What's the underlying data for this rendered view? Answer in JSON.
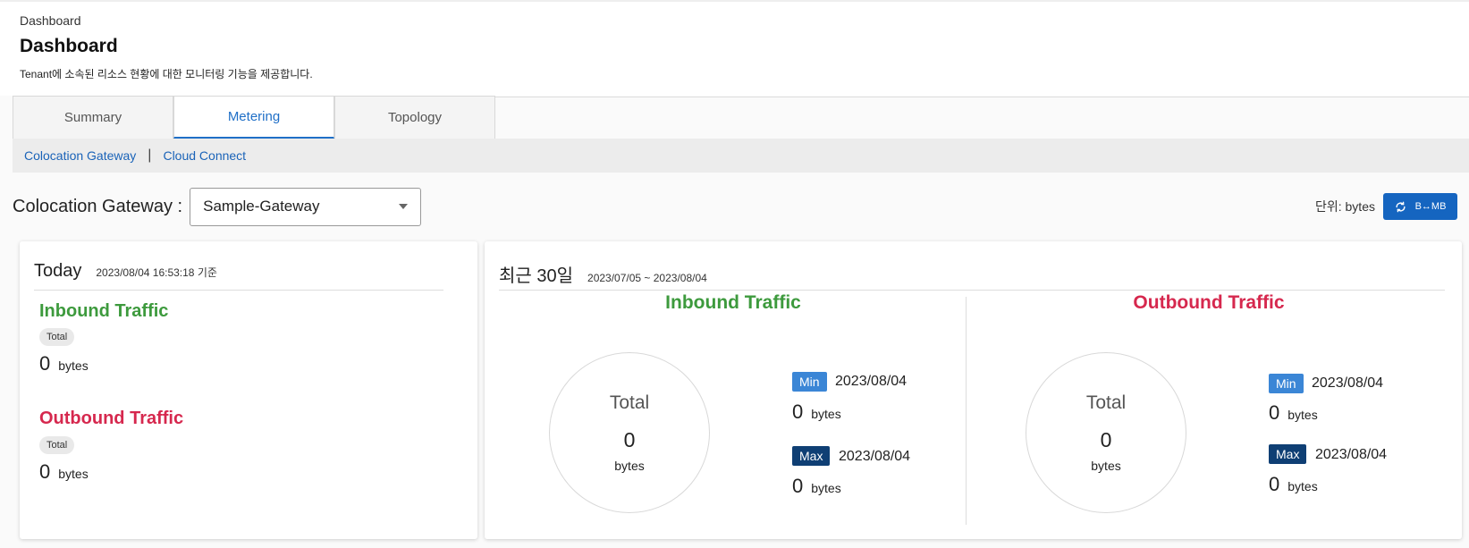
{
  "header": {
    "breadcrumb": "Dashboard",
    "title": "Dashboard",
    "description": "Tenant에 소속된 리소스 현황에 대한 모니터링 기능을 제공합니다."
  },
  "tabs": [
    {
      "label": "Summary",
      "active": false
    },
    {
      "label": "Metering",
      "active": true
    },
    {
      "label": "Topology",
      "active": false
    }
  ],
  "subnav": {
    "items": [
      "Colocation Gateway",
      "Cloud Connect"
    ],
    "separator": "|"
  },
  "selector": {
    "label": "Colocation Gateway :",
    "value": "Sample-Gateway"
  },
  "unit": {
    "text": "단위: bytes",
    "button_label": "B↔MB"
  },
  "today": {
    "title": "Today",
    "timestamp": "2023/08/04 16:53:18 기준",
    "inbound": {
      "title": "Inbound Traffic",
      "pill": "Total",
      "value": "0",
      "unit": "bytes"
    },
    "outbound": {
      "title": "Outbound Traffic",
      "pill": "Total",
      "value": "0",
      "unit": "bytes"
    }
  },
  "recent": {
    "title": "최근 30일",
    "range": "2023/07/05 ~ 2023/08/04",
    "inbound": {
      "title": "Inbound Traffic",
      "total_label": "Total",
      "total_value": "0",
      "total_unit": "bytes",
      "min_label": "Min",
      "min_date": "2023/08/04",
      "min_value": "0",
      "min_unit": "bytes",
      "max_label": "Max",
      "max_date": "2023/08/04",
      "max_value": "0",
      "max_unit": "bytes"
    },
    "outbound": {
      "title": "Outbound Traffic",
      "total_label": "Total",
      "total_value": "0",
      "total_unit": "bytes",
      "min_label": "Min",
      "min_date": "2023/08/04",
      "min_value": "0",
      "min_unit": "bytes",
      "max_label": "Max",
      "max_date": "2023/08/04",
      "max_value": "0",
      "max_unit": "bytes"
    }
  },
  "colors": {
    "accent": "#1f6fc7",
    "inbound": "#3d9a3d",
    "outbound": "#d6284e",
    "min_badge": "#3b86d6",
    "max_badge": "#0f3f74",
    "button": "#1565c0"
  },
  "icons": {
    "unit_button": "refresh-icon",
    "select": "caret-down-icon"
  }
}
